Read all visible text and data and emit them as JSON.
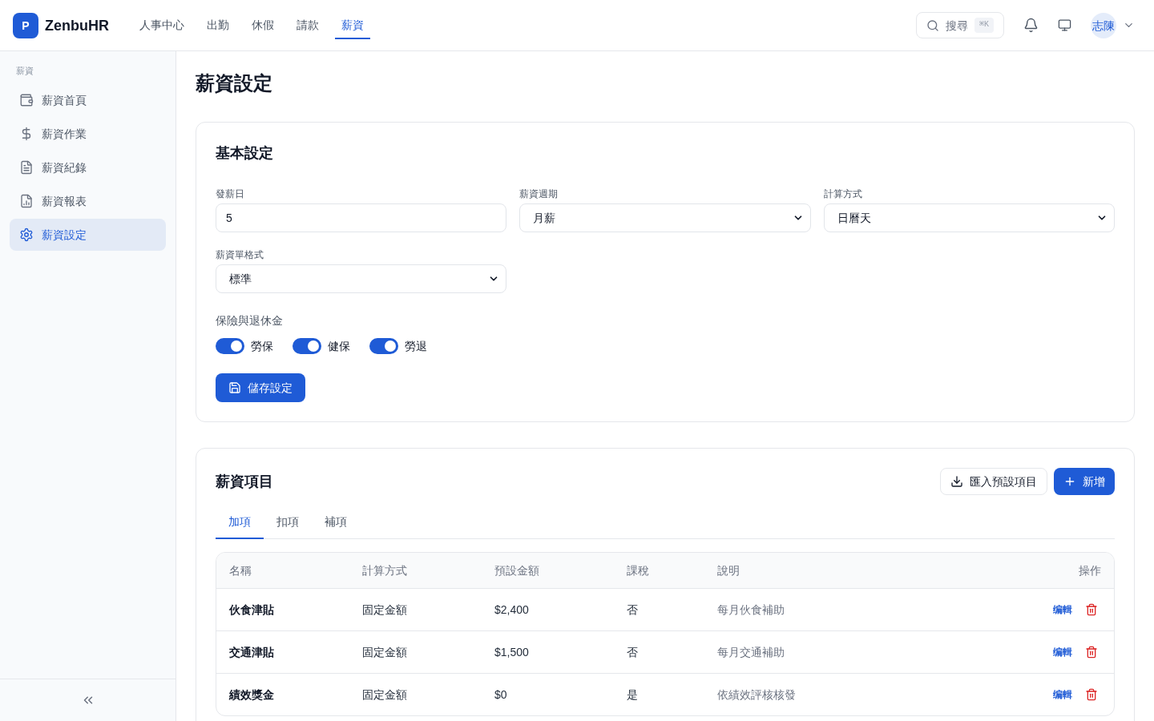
{
  "header": {
    "logo": "P",
    "brand": "ZenbuHR",
    "nav": [
      {
        "label": "人事中心",
        "selected": false
      },
      {
        "label": "出勤",
        "selected": false
      },
      {
        "label": "休假",
        "selected": false
      },
      {
        "label": "請款",
        "selected": false
      },
      {
        "label": "薪資",
        "selected": true
      }
    ],
    "search": {
      "label": "搜尋",
      "shortcut": "⌘K"
    },
    "user": {
      "avatar": "志陳"
    }
  },
  "sidebar": {
    "section": "薪資",
    "items": [
      {
        "label": "薪資首頁",
        "selected": false
      },
      {
        "label": "薪資作業",
        "selected": false
      },
      {
        "label": "薪資紀錄",
        "selected": false
      },
      {
        "label": "薪資報表",
        "selected": false
      },
      {
        "label": "薪資設定",
        "selected": true
      }
    ]
  },
  "page": {
    "title": "薪資設定"
  },
  "basic_settings": {
    "title": "基本設定",
    "fields": [
      {
        "label": "發薪日",
        "kind": "input",
        "value": "5"
      },
      {
        "label": "薪資週期",
        "kind": "select",
        "value": "月薪"
      },
      {
        "label": "計算方式",
        "kind": "select",
        "value": "日曆天"
      },
      {
        "label": "薪資單格式",
        "kind": "select",
        "value": "標準"
      }
    ],
    "insurance": {
      "label": "保險與退休金",
      "toggles": [
        {
          "label": "勞保",
          "on": true
        },
        {
          "label": "健保",
          "on": true
        },
        {
          "label": "勞退",
          "on": true
        }
      ]
    },
    "save_button": "儲存設定"
  },
  "pay_items": {
    "title": "薪資項目",
    "import_button": "匯入預設項目",
    "add_button": "新增",
    "tabs": [
      {
        "label": "加項",
        "selected": true
      },
      {
        "label": "扣項",
        "selected": false
      },
      {
        "label": "補項",
        "selected": false
      }
    ],
    "table": {
      "columns": [
        "名稱",
        "計算方式",
        "預設金額",
        "課稅",
        "說明",
        "操作"
      ],
      "rows": [
        {
          "name": "伙食津貼",
          "method": "固定金額",
          "amount": "$2,400",
          "taxable": "否",
          "description": "每月伙食補助",
          "edit": "编輯"
        },
        {
          "name": "交通津貼",
          "method": "固定金額",
          "amount": "$1,500",
          "taxable": "否",
          "description": "每月交通補助",
          "edit": "编輯"
        },
        {
          "name": "績效獎金",
          "method": "固定金額",
          "amount": "$0",
          "taxable": "是",
          "description": "依績效評核核發",
          "edit": "编輯"
        }
      ]
    }
  }
}
